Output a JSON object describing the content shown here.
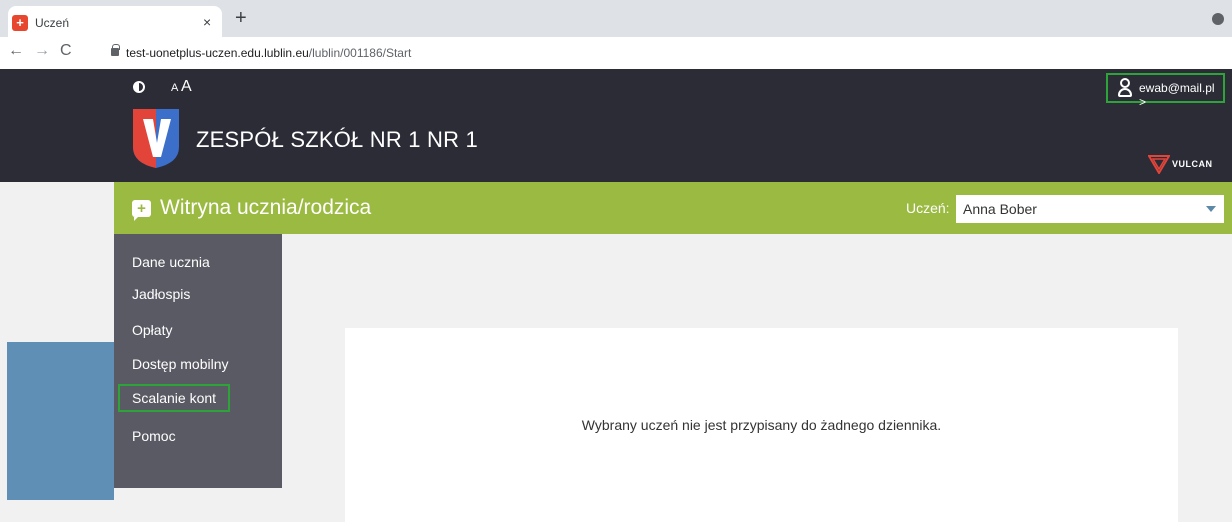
{
  "browser": {
    "tab_title": "Uczeń",
    "tab_close": "×",
    "new_tab": "+",
    "url_host": "test-uonetplus-uczen.edu.lublin.eu",
    "url_path": "/lublin/001186/Start"
  },
  "header": {
    "font_small": "A",
    "font_big": "A",
    "account": "ewab@mail.pl >",
    "school_name": "ZESPÓŁ SZKÓŁ NR 1 NR 1",
    "vulcan": "VULCAN"
  },
  "nav": {
    "title": "Witryna ucznia/rodzica",
    "student_label": "Uczeń:",
    "student_value": "Anna Bober"
  },
  "sidebar": {
    "items": [
      {
        "label": "Dane ucznia"
      },
      {
        "label": "Jadłospis"
      },
      {
        "label": "Opłaty"
      },
      {
        "label": "Dostęp mobilny"
      },
      {
        "label": "Scalanie kont"
      },
      {
        "label": "Pomoc"
      }
    ]
  },
  "main": {
    "message": "Wybrany uczeń nie jest przypisany do żadnego dziennika."
  },
  "colors": {
    "header_bg": "#2c2c37",
    "green": "#9bba41",
    "sidebar_bg": "#595a63",
    "highlight": "#2ea33a",
    "blue": "#5f8fb4"
  }
}
